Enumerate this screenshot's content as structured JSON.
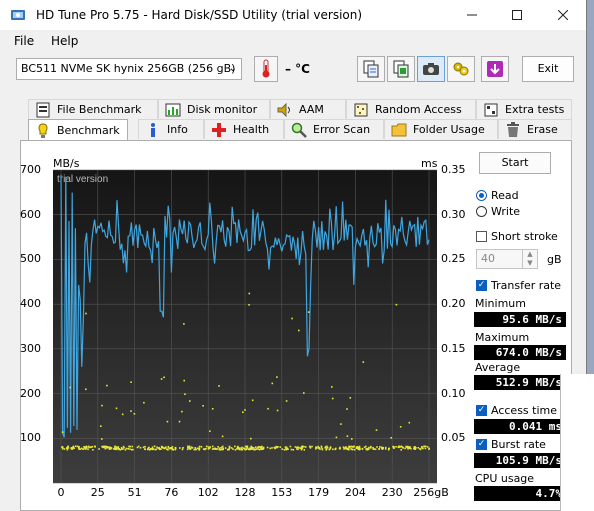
{
  "window": {
    "title": "HD Tune Pro 5.75 - Hard Disk/SSD Utility (trial version)"
  },
  "menu": {
    "file": "File",
    "help": "Help"
  },
  "toolbar": {
    "drive": "BC511 NVMe SK hynix 256GB (256 gB)",
    "temperature": "– °C",
    "exit_label": "Exit",
    "icons": [
      "copy-info-icon",
      "copy-screenshot-icon",
      "camera-icon",
      "options-icon",
      "save-icon"
    ]
  },
  "tabs_top": [
    {
      "label": "File Benchmark",
      "icon": "file-benchmark-icon"
    },
    {
      "label": "Disk monitor",
      "icon": "disk-monitor-icon"
    },
    {
      "label": "AAM",
      "icon": "speaker-icon"
    },
    {
      "label": "Random Access",
      "icon": "random-access-icon"
    },
    {
      "label": "Extra tests",
      "icon": "extra-tests-icon"
    }
  ],
  "tabs_bottom": [
    {
      "label": "Benchmark",
      "icon": "benchmark-icon",
      "active": true
    },
    {
      "label": "Info",
      "icon": "info-icon"
    },
    {
      "label": "Health",
      "icon": "health-icon"
    },
    {
      "label": "Error Scan",
      "icon": "error-scan-icon"
    },
    {
      "label": "Folder Usage",
      "icon": "folder-icon"
    },
    {
      "label": "Erase",
      "icon": "erase-icon"
    }
  ],
  "graph": {
    "left_unit": "MB/s",
    "right_unit": "ms",
    "watermark": "trial version",
    "y_left": [
      "700",
      "600",
      "500",
      "400",
      "300",
      "200",
      "100"
    ],
    "y_right": [
      "0.35",
      "0.30",
      "0.25",
      "0.20",
      "0.15",
      "0.10",
      "0.05"
    ],
    "x_ticks": [
      "0",
      "25",
      "51",
      "76",
      "102",
      "128",
      "153",
      "179",
      "204",
      "230",
      "256gB"
    ],
    "transfer_color": "#3fa6e0",
    "access_color": "#e8e83a"
  },
  "controls": {
    "start_label": "Start",
    "read_label": "Read",
    "write_label": "Write",
    "mode_selected": "Read",
    "short_stroke_label": "Short stroke",
    "short_stroke_checked": false,
    "short_stroke_value": "40",
    "short_stroke_unit": "gB",
    "transfer_rate_label": "Transfer rate",
    "transfer_rate_checked": true,
    "access_time_label": "Access time",
    "access_time_checked": true,
    "burst_rate_label": "Burst rate",
    "burst_rate_checked": true
  },
  "stats": {
    "minimum_label": "Minimum",
    "minimum": "95.6 MB/s",
    "maximum_label": "Maximum",
    "maximum": "674.0 MB/s",
    "average_label": "Average",
    "average": "512.9 MB/s",
    "access_time": "0.041 ms",
    "burst_rate": "105.9 MB/s",
    "cpu_label": "CPU usage",
    "cpu": "4.7%"
  }
}
